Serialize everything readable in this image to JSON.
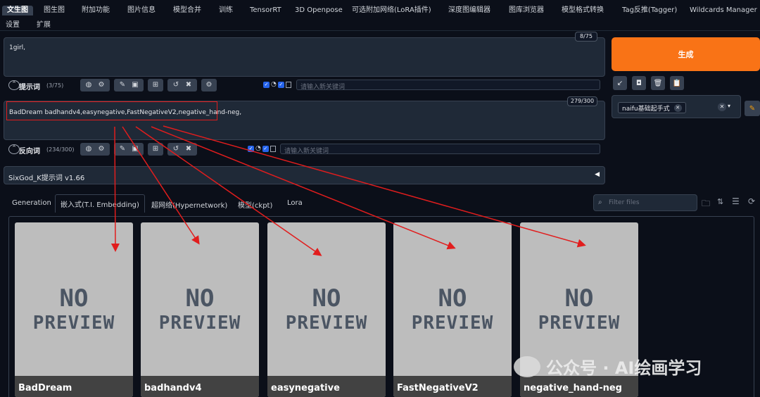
{
  "top_tabs": [
    "文生图",
    "图生图",
    "附加功能",
    "图片信息",
    "模型合并",
    "训练",
    "TensorRT",
    "3D Openpose",
    "可选附加网络(LoRA插件)",
    "深度图编辑器",
    "图库浏览器",
    "模型格式转换",
    "Tag反推(Tagger)",
    "Wildcards Manager"
  ],
  "top_tabs_row2": [
    "设置",
    "扩展"
  ],
  "positive": {
    "text": "1girl,",
    "counter": "8/75",
    "label": "提示词",
    "count": "(3/75)",
    "keyword_placeholder": "请输入新关键词"
  },
  "negative": {
    "text": "BadDream badhandv4,easynegative,FastNegativeV2,negative_hand-neg,",
    "counter": "279/300",
    "label": "反向词",
    "count": "(234/300)",
    "keyword_placeholder": "请输入新关键词"
  },
  "generate_label": "生成",
  "style_select": {
    "tag": "naifu基础起手式"
  },
  "sixgod_label": "SixGod_K提示词 v1.66",
  "sub_tabs": [
    "Generation",
    "嵌入式(T.I. Embedding)",
    "超网络(Hypernetwork)",
    "模型(ckpt)",
    "Lora"
  ],
  "filter_placeholder": "Filter files",
  "cards": [
    {
      "name": "BadDream",
      "preview_line1": "NO",
      "preview_line2": "PREVIEW"
    },
    {
      "name": "badhandv4",
      "preview_line1": "NO",
      "preview_line2": "PREVIEW"
    },
    {
      "name": "easynegative",
      "preview_line1": "NO",
      "preview_line2": "PREVIEW"
    },
    {
      "name": "FastNegativeV2",
      "preview_line1": "NO",
      "preview_line2": "PREVIEW"
    },
    {
      "name": "negative_hand-neg",
      "preview_line1": "NO",
      "preview_line2": "PREVIEW"
    }
  ],
  "watermark": "公众号 · AI绘画学习",
  "colors": {
    "accent": "#f97316",
    "annotation": "#e11d1d",
    "background": "#0b0f19",
    "panel": "#1f2937"
  }
}
